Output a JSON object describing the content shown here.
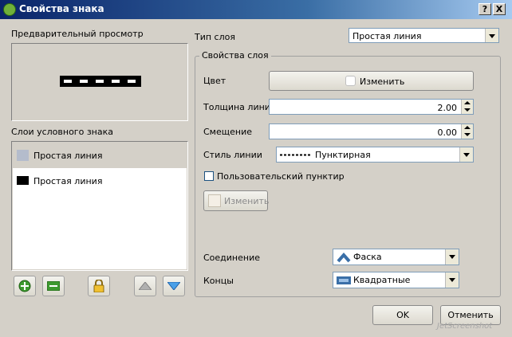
{
  "window": {
    "title": "Свойства знака",
    "help_label": "?",
    "close_label": "X"
  },
  "preview": {
    "label": "Предварительный просмотр"
  },
  "layers": {
    "label": "Слои условного знака",
    "items": [
      {
        "label": "Простая линия",
        "swatch": "#b4bccc",
        "selected": false
      },
      {
        "label": "Простая линия",
        "swatch": "#000000",
        "selected": true
      }
    ]
  },
  "layer_type": {
    "label": "Тип слоя",
    "value": "Простая линия"
  },
  "props": {
    "title": "Свойства слоя",
    "color": {
      "label": "Цвет",
      "button": "Изменить",
      "swatch": "#ffffff"
    },
    "width": {
      "label": "Толщина линии",
      "value": "2.00"
    },
    "offset": {
      "label": "Смещение",
      "value": "0.00"
    },
    "style": {
      "label": "Стиль линии",
      "value": "Пунктирная"
    },
    "custom_dash": {
      "label": "Пользовательский пунктир",
      "checked": false,
      "button": "Изменить"
    },
    "join": {
      "label": "Соединение",
      "value": "Фаска"
    },
    "cap": {
      "label": "Концы",
      "value": "Квадратные"
    }
  },
  "footer": {
    "ok": "OK",
    "cancel": "Отменить",
    "watermark": "JetScreenshot"
  },
  "colors": {
    "title_start": "#0a246a",
    "title_end": "#a6caf0",
    "face": "#d4d0c8",
    "selected_row": "#ffffff"
  }
}
